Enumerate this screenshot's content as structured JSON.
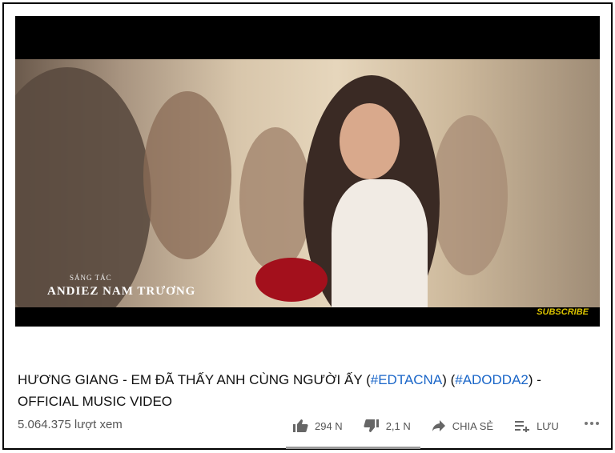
{
  "video": {
    "credit_label": "SÁNG TÁC",
    "credit_name": "ANDIEZ NAM TRƯƠNG",
    "subscribe_label": "SUBSCRIBE"
  },
  "title": {
    "part1": "HƯƠNG GIANG - EM ĐÃ THẤY ANH CÙNG NGƯỜI ẤY (",
    "tag1": "#EDTACNA",
    "part2": ") (",
    "tag2": "#ADODDA2",
    "part3": ") -",
    "part4": "OFFICIAL MUSIC VIDEO"
  },
  "views": "5.064.375 lượt xem",
  "actions": {
    "like_count": "294 N",
    "dislike_count": "2,1 N",
    "share_label": "CHIA SẺ",
    "save_label": "LƯU"
  },
  "colors": {
    "link": "#1a66c8",
    "subscribe": "#d9c200"
  }
}
